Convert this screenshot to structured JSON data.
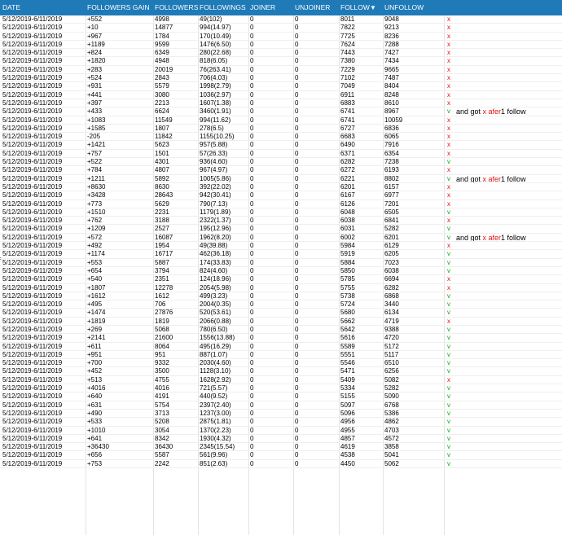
{
  "headers": {
    "date": "DATE",
    "followers_gain": "FOLLOWERS GAIN",
    "followers": "FOLLOWERS",
    "followings": "FOLLOWINGS",
    "joiner": "JOINER",
    "unjoiner": "UNJOINER",
    "follow": "FOLLOW",
    "unfollow": "UNFOLLOW"
  },
  "icons": {
    "filter": "filter-icon",
    "cross": "x-mark",
    "check": "check-mark"
  },
  "colors": {
    "header_bg": "#1f7ab8",
    "cross": "#dd1111",
    "check": "#11aa11"
  },
  "note_parts": {
    "prefix": "and got ",
    "x": "x",
    "afer": " afer",
    "suffix": "1 follow"
  },
  "rows": [
    [
      "5/12/2019-6/11/2019",
      "+552",
      "4998",
      "49(102)",
      "0",
      "0",
      "8011",
      "9048",
      "x",
      ""
    ],
    [
      "5/12/2019-6/11/2019",
      "+10",
      "14877",
      "994(14.97)",
      "0",
      "0",
      "7822",
      "9213",
      "x",
      ""
    ],
    [
      "5/12/2019-6/11/2019",
      "+967",
      "1784",
      "170(10.49)",
      "0",
      "0",
      "7725",
      "8236",
      "x",
      ""
    ],
    [
      "5/12/2019-6/11/2019",
      "+1189",
      "9599",
      "1476(6.50)",
      "0",
      "0",
      "7624",
      "7288",
      "x",
      ""
    ],
    [
      "5/12/2019-6/11/2019",
      "+824",
      "6349",
      "280(22.68)",
      "0",
      "0",
      "7443",
      "7427",
      "x",
      ""
    ],
    [
      "5/12/2019-6/11/2019",
      "+1820",
      "4948",
      "818(6.05)",
      "0",
      "0",
      "7380",
      "7434",
      "x",
      ""
    ],
    [
      "5/12/2019-6/11/2019",
      "+283",
      "20019",
      "76(263.41)",
      "0",
      "0",
      "7229",
      "9665",
      "x",
      ""
    ],
    [
      "5/12/2019-6/11/2019",
      "+524",
      "2843",
      "706(4.03)",
      "0",
      "0",
      "7102",
      "7487",
      "x",
      ""
    ],
    [
      "5/12/2019-6/11/2019",
      "+931",
      "5579",
      "1998(2.79)",
      "0",
      "0",
      "7049",
      "8404",
      "x",
      ""
    ],
    [
      "5/12/2019-6/11/2019",
      "+441",
      "3080",
      "1036(2.97)",
      "0",
      "0",
      "6911",
      "8248",
      "x",
      ""
    ],
    [
      "5/12/2019-6/11/2019",
      "+397",
      "2213",
      "1607(1.38)",
      "0",
      "0",
      "6883",
      "8610",
      "x",
      ""
    ],
    [
      "5/12/2019-6/11/2019",
      "+433",
      "6624",
      "3460(1.91)",
      "0",
      "0",
      "6741",
      "8967",
      "v",
      "note"
    ],
    [
      "5/12/2019-6/11/2019",
      "+1083",
      "11549",
      "994(11.62)",
      "0",
      "0",
      "6741",
      "10059",
      "x",
      ""
    ],
    [
      "5/12/2019-6/11/2019",
      "+1585",
      "1807",
      "278(6.5)",
      "0",
      "0",
      "6727",
      "6836",
      "x",
      ""
    ],
    [
      "5/12/2019-6/11/2019",
      "-205",
      "11842",
      "1155(10.25)",
      "0",
      "0",
      "6683",
      "6065",
      "x",
      ""
    ],
    [
      "5/12/2019-6/11/2019",
      "+1421",
      "5623",
      "957(5.88)",
      "0",
      "0",
      "6490",
      "7916",
      "x",
      ""
    ],
    [
      "5/12/2019-6/11/2019",
      "+757",
      "1501",
      "57(26.33)",
      "0",
      "0",
      "6371",
      "6354",
      "x",
      ""
    ],
    [
      "5/12/2019-6/11/2019",
      "+522",
      "4301",
      "936(4.60)",
      "0",
      "0",
      "6282",
      "7238",
      "v",
      ""
    ],
    [
      "5/12/2019-6/11/2019",
      "+784",
      "4807",
      "967(4.97)",
      "0",
      "0",
      "6272",
      "6193",
      "x",
      ""
    ],
    [
      "5/12/2019-6/11/2019",
      "+1211",
      "5892",
      "1005(5.86)",
      "0",
      "0",
      "6221",
      "8802",
      "v",
      "note"
    ],
    [
      "5/12/2019-6/11/2019",
      "+8630",
      "8630",
      "392(22.02)",
      "0",
      "0",
      "6201",
      "6157",
      "x",
      ""
    ],
    [
      "5/12/2019-6/11/2019",
      "+3428",
      "28643",
      "942(30.41)",
      "0",
      "0",
      "6167",
      "6977",
      "x",
      ""
    ],
    [
      "5/12/2019-6/11/2019",
      "+773",
      "5629",
      "790(7.13)",
      "0",
      "0",
      "6126",
      "7201",
      "x",
      ""
    ],
    [
      "5/12/2019-6/11/2019",
      "+1510",
      "2231",
      "1179(1.89)",
      "0",
      "0",
      "6048",
      "6505",
      "v",
      ""
    ],
    [
      "5/12/2019-6/11/2019",
      "+762",
      "3188",
      "2322(1.37)",
      "0",
      "0",
      "6038",
      "6841",
      "x",
      ""
    ],
    [
      "5/12/2019-6/11/2019",
      "+1209",
      "2527",
      "195(12.96)",
      "0",
      "0",
      "6031",
      "5282",
      "v",
      ""
    ],
    [
      "5/12/2019-6/11/2019",
      "+572",
      "16087",
      "1962(8.20)",
      "0",
      "0",
      "6002",
      "6201",
      "v",
      "note"
    ],
    [
      "5/12/2019-6/11/2019",
      "+492",
      "1954",
      "49(39.88)",
      "0",
      "0",
      "5984",
      "6129",
      "x",
      ""
    ],
    [
      "5/12/2019-6/11/2019",
      "+1174",
      "16717",
      "462(36.18)",
      "0",
      "0",
      "5919",
      "6205",
      "v",
      ""
    ],
    [
      "5/12/2019-6/11/2019",
      "+553",
      "5887",
      "174(33.83)",
      "0",
      "0",
      "5884",
      "7023",
      "v",
      ""
    ],
    [
      "5/12/2019-6/11/2019",
      "+654",
      "3794",
      "824(4.60)",
      "0",
      "0",
      "5850",
      "6038",
      "v",
      ""
    ],
    [
      "5/12/2019-6/11/2019",
      "+540",
      "2351",
      "124(18.96)",
      "0",
      "0",
      "5785",
      "6694",
      "x",
      ""
    ],
    [
      "5/12/2019-6/11/2019",
      "+1807",
      "12278",
      "2054(5.98)",
      "0",
      "0",
      "5755",
      "6282",
      "x",
      ""
    ],
    [
      "5/12/2019-6/11/2019",
      "+1612",
      "1612",
      "499(3.23)",
      "0",
      "0",
      "5738",
      "6868",
      "v",
      ""
    ],
    [
      "5/12/2019-6/11/2019",
      "+495",
      "706",
      "2004(0.35)",
      "0",
      "0",
      "5724",
      "3440",
      "v",
      ""
    ],
    [
      "5/12/2019-6/11/2019",
      "+1474",
      "27876",
      "520(53.61)",
      "0",
      "0",
      "5680",
      "6134",
      "v",
      ""
    ],
    [
      "5/12/2019-6/11/2019",
      "+1819",
      "1819",
      "2066(0.88)",
      "0",
      "0",
      "5662",
      "4719",
      "x",
      ""
    ],
    [
      "5/12/2019-6/11/2019",
      "+269",
      "5068",
      "780(6.50)",
      "0",
      "0",
      "5642",
      "9388",
      "v",
      ""
    ],
    [
      "5/12/2019-6/11/2019",
      "+2141",
      "21600",
      "1556(13.88)",
      "0",
      "0",
      "5616",
      "4720",
      "v",
      ""
    ],
    [
      "5/12/2019-6/11/2019",
      "+611",
      "8064",
      "495(16.29)",
      "0",
      "0",
      "5589",
      "5172",
      "v",
      ""
    ],
    [
      "5/12/2019-6/11/2019",
      "+951",
      "951",
      "887(1.07)",
      "0",
      "0",
      "5551",
      "5117",
      "v",
      ""
    ],
    [
      "5/12/2019-6/11/2019",
      "+700",
      "9332",
      "2030(4.60)",
      "0",
      "0",
      "5546",
      "6510",
      "v",
      ""
    ],
    [
      "5/12/2019-6/11/2019",
      "+452",
      "3500",
      "1128(3.10)",
      "0",
      "0",
      "5471",
      "6256",
      "v",
      ""
    ],
    [
      "5/12/2019-6/11/2019",
      "+513",
      "4755",
      "1628(2.92)",
      "0",
      "0",
      "5409",
      "5082",
      "x",
      ""
    ],
    [
      "5/12/2019-6/11/2019",
      "+4016",
      "4016",
      "721(5.57)",
      "0",
      "0",
      "5334",
      "5282",
      "v",
      ""
    ],
    [
      "5/12/2019-6/11/2019",
      "+640",
      "4191",
      "440(9.52)",
      "0",
      "0",
      "5155",
      "5090",
      "v",
      ""
    ],
    [
      "5/12/2019-6/11/2019",
      "+631",
      "5754",
      "2397(2.40)",
      "0",
      "0",
      "5097",
      "6768",
      "v",
      ""
    ],
    [
      "5/12/2019-6/11/2019",
      "+490",
      "3713",
      "1237(3.00)",
      "0",
      "0",
      "5096",
      "5386",
      "v",
      ""
    ],
    [
      "5/12/2019-6/11/2019",
      "+533",
      "5208",
      "2875(1.81)",
      "0",
      "0",
      "4956",
      "4862",
      "v",
      ""
    ],
    [
      "5/12/2019-6/11/2019",
      "+1010",
      "3054",
      "1370(2.23)",
      "0",
      "0",
      "4955",
      "4703",
      "v",
      ""
    ],
    [
      "5/12/2019-6/11/2019",
      "+641",
      "8342",
      "1930(4.32)",
      "0",
      "0",
      "4857",
      "4572",
      "v",
      ""
    ],
    [
      "5/12/2019-6/11/2019",
      "+36430",
      "36430",
      "2345(15.54)",
      "0",
      "0",
      "4619",
      "3858",
      "v",
      ""
    ],
    [
      "5/12/2019-6/11/2019",
      "+656",
      "5587",
      "561(9.96)",
      "0",
      "0",
      "4538",
      "5041",
      "v",
      ""
    ],
    [
      "5/12/2019-6/11/2019",
      "+753",
      "2242",
      "851(2.63)",
      "0",
      "0",
      "4450",
      "5062",
      "v",
      ""
    ]
  ]
}
